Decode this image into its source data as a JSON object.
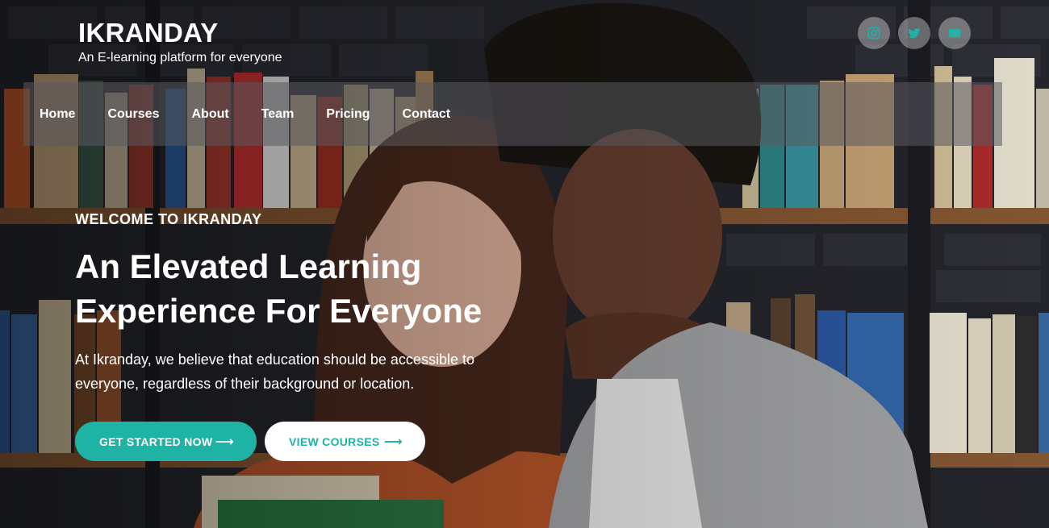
{
  "brand": {
    "name": "IKRANDAY",
    "tagline": "An E-learning platform for everyone"
  },
  "socials": [
    {
      "icon": "instagram-icon"
    },
    {
      "icon": "twitter-icon"
    },
    {
      "icon": "youtube-icon"
    }
  ],
  "nav": [
    "Home",
    "Courses",
    "About",
    "Team",
    "Pricing",
    "Contact"
  ],
  "hero": {
    "eyebrow": "WELCOME TO IKRANDAY",
    "title": "An Elevated Learning Experience For Everyone",
    "description": "At Ikranday, we believe that education should be accessible to everyone, regardless of their background or location.",
    "primary_button": "GET STARTED NOW",
    "secondary_button": "VIEW COURSES",
    "arrow": "⟶"
  },
  "colors": {
    "accent": "#1fb3a5",
    "white": "#ffffff"
  }
}
